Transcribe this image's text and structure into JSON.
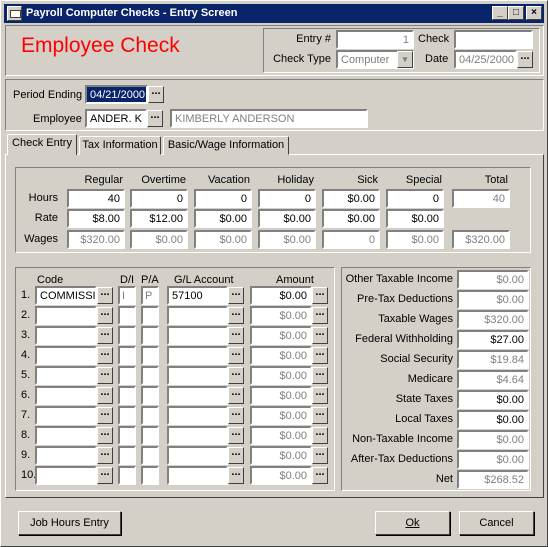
{
  "window": {
    "title": "Payroll Computer Checks - Entry Screen",
    "min": "_",
    "max": "□",
    "close": "×"
  },
  "header": {
    "heading": "Employee Check",
    "entry_label": "Entry #",
    "entry_value": "1",
    "check_label": "Check",
    "check_value": "",
    "check_type_label": "Check Type",
    "check_type_value": "Computer",
    "date_label": "Date",
    "date_value": "04/25/2000"
  },
  "period": {
    "label": "Period Ending",
    "value": "04/21/2000"
  },
  "employee": {
    "label": "Employee",
    "code": "ANDER. K",
    "name": "KIMBERLY ANDERSON"
  },
  "tabs": [
    {
      "label": "Check Entry"
    },
    {
      "label": "Tax Information"
    },
    {
      "label": "Basic/Wage Information"
    }
  ],
  "grid": {
    "columns": [
      "Regular",
      "Overtime",
      "Vacation",
      "Holiday",
      "Sick",
      "Special",
      "Total"
    ],
    "rows": [
      {
        "label": "Hours",
        "values": [
          "40",
          "0",
          "0",
          "0",
          "$0.00",
          "0",
          "40"
        ]
      },
      {
        "label": "Rate",
        "values": [
          "$8.00",
          "$12.00",
          "$0.00",
          "$0.00",
          "$0.00",
          "$0.00",
          ""
        ]
      },
      {
        "label": "Wages",
        "values": [
          "$320.00",
          "$0.00",
          "$0.00",
          "$0.00",
          "0",
          "$0.00",
          "$320.00"
        ]
      }
    ]
  },
  "lines": {
    "headers": {
      "code": "Code",
      "di": "D/I",
      "pa": "P/A",
      "gl": "G/L Account",
      "amount": "Amount"
    },
    "rows": [
      {
        "num": "1.",
        "code": "COMMISSIO",
        "di": "I",
        "pa": "P",
        "gl": "57100",
        "amount": "$0.00"
      },
      {
        "num": "2.",
        "code": "",
        "di": "",
        "pa": "",
        "gl": "",
        "amount": "$0.00"
      },
      {
        "num": "3.",
        "code": "",
        "di": "",
        "pa": "",
        "gl": "",
        "amount": "$0.00"
      },
      {
        "num": "4.",
        "code": "",
        "di": "",
        "pa": "",
        "gl": "",
        "amount": "$0.00"
      },
      {
        "num": "5.",
        "code": "",
        "di": "",
        "pa": "",
        "gl": "",
        "amount": "$0.00"
      },
      {
        "num": "6.",
        "code": "",
        "di": "",
        "pa": "",
        "gl": "",
        "amount": "$0.00"
      },
      {
        "num": "7.",
        "code": "",
        "di": "",
        "pa": "",
        "gl": "",
        "amount": "$0.00"
      },
      {
        "num": "8.",
        "code": "",
        "di": "",
        "pa": "",
        "gl": "",
        "amount": "$0.00"
      },
      {
        "num": "9.",
        "code": "",
        "di": "",
        "pa": "",
        "gl": "",
        "amount": "$0.00"
      },
      {
        "num": "10.",
        "code": "",
        "di": "",
        "pa": "",
        "gl": "",
        "amount": "$0.00"
      }
    ]
  },
  "summary": [
    {
      "label": "Other Taxable Income",
      "value": "$0.00"
    },
    {
      "label": "Pre-Tax Deductions",
      "value": "$0.00"
    },
    {
      "label": "Taxable Wages",
      "value": "$320.00"
    },
    {
      "label": "Federal Withholding",
      "value": "$27.00"
    },
    {
      "label": "Social Security",
      "value": "$19.84"
    },
    {
      "label": "Medicare",
      "value": "$4.64"
    },
    {
      "label": "State Taxes",
      "value": "$0.00"
    },
    {
      "label": "Local Taxes",
      "value": "$0.00"
    },
    {
      "label": "Non-Taxable Income",
      "value": "$0.00"
    },
    {
      "label": "After-Tax Deductions",
      "value": "$0.00"
    },
    {
      "label": "Net",
      "value": "$268.52"
    }
  ],
  "buttons": {
    "job_hours": "Job Hours Entry",
    "ok": "Ok",
    "cancel": "Cancel"
  },
  "ellipsis": "...",
  "dropdown_arrow": "▾",
  "colors": {
    "title_bg": "#0a246a",
    "heading": "#ff0000",
    "face": "#d4d0c8"
  }
}
